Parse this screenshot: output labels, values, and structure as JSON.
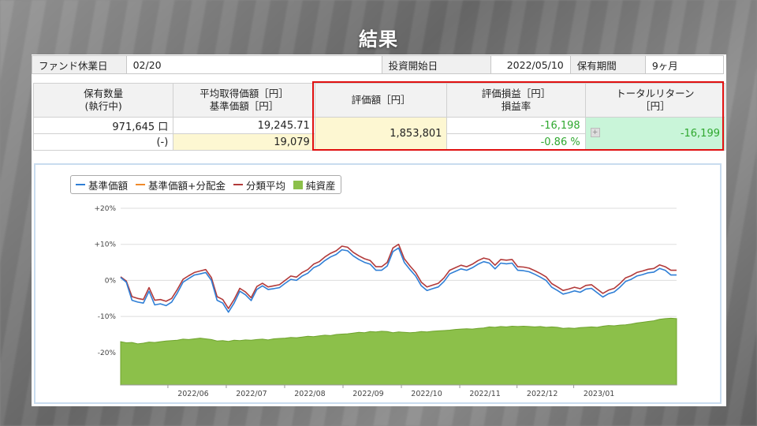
{
  "title": "結果",
  "info": {
    "holiday_label": "ファンド休業日",
    "holiday_value": "02/20",
    "start_label": "投資開始日",
    "start_value": "2022/05/10",
    "period_label": "保有期間",
    "period_value": "9ヶ月"
  },
  "summary": {
    "h_qty_1": "保有数量",
    "h_qty_2": "(執行中)",
    "h_avg_1": "平均取得価額［円］",
    "h_avg_2": "基準価額［円］",
    "h_val": "評価額［円］",
    "h_pl_1": "評価損益［円］",
    "h_pl_2": "損益率",
    "h_tr_1": "トータルリターン",
    "h_tr_2": "［円］",
    "qty": "971,645 口",
    "pending": "(-)",
    "avg_price": "19,245.71",
    "base_price": "19,079",
    "valuation": "1,853,801",
    "pl": "-16,198",
    "pl_rate": "-0.86 %",
    "total_return": "-16,199"
  },
  "legend": {
    "s1": "基準価額",
    "s2": "基準価額+分配金",
    "s3": "分類平均",
    "s4": "純資産"
  },
  "colors": {
    "s1": "#2f7fd6",
    "s2": "#f08a2a",
    "s3": "#b23a3a",
    "s4": "#8cc04a",
    "highlight": "#e01010"
  },
  "chart_data": {
    "type": "line",
    "y_ticks": [
      "+20%",
      "+10%",
      "0%",
      "-10%",
      "-20%"
    ],
    "ylim": [
      -29,
      20
    ],
    "x_ticks": [
      "2022/06",
      "2022/07",
      "2022/08",
      "2022/09",
      "2022/10",
      "2022/11",
      "2022/12",
      "2023/01"
    ],
    "x_tick_pos": [
      0.085,
      0.19,
      0.295,
      0.4,
      0.505,
      0.61,
      0.713,
      0.815
    ],
    "series": [
      {
        "name": "基準価額",
        "values": [
          0.8,
          -0.5,
          -5.5,
          -6,
          -6.3,
          -3,
          -6.8,
          -6.5,
          -7,
          -6,
          -3.5,
          -0.5,
          0.5,
          1.5,
          1.8,
          2.2,
          0,
          -5.5,
          -6.3,
          -8.8,
          -6.3,
          -3,
          -4,
          -5.6,
          -2.5,
          -1.5,
          -2.5,
          -2.3,
          -2,
          -0.8,
          0.3,
          0,
          1.2,
          2,
          3.5,
          4.2,
          5.5,
          6.5,
          7.2,
          8.5,
          8.2,
          6.8,
          5.8,
          5,
          4.5,
          2.8,
          2.8,
          4,
          8,
          9,
          5,
          3,
          1.2,
          -1.5,
          -2.8,
          -2.3,
          -1.8,
          -0.3,
          1.8,
          2.5,
          3.2,
          2.8,
          3.5,
          4.5,
          5.2,
          4.8,
          3.2,
          4.8,
          4.6,
          4.8,
          2.8,
          2.7,
          2.4,
          1.7,
          0.9,
          0,
          -1.9,
          -2.8,
          -3.8,
          -3.4,
          -2.9,
          -3.3,
          -2.4,
          -2.2,
          -3.4,
          -4.6,
          -3.7,
          -3.2,
          -1.9,
          -0.3,
          0.3,
          1.2,
          1.6,
          2.1,
          2.3,
          3.3,
          2.8,
          1.5,
          1.5
        ]
      },
      {
        "name": "分類平均",
        "values": [
          1,
          -0.2,
          -4.5,
          -5,
          -5.3,
          -2,
          -5.5,
          -5.3,
          -5.8,
          -5,
          -2.5,
          0.3,
          1.3,
          2.2,
          2.6,
          3,
          0.8,
          -4.5,
          -5.3,
          -7.8,
          -5.3,
          -2.2,
          -3.2,
          -4.8,
          -1.7,
          -0.8,
          -1.8,
          -1.5,
          -1.2,
          0,
          1.2,
          0.9,
          2.2,
          3,
          4.5,
          5.2,
          6.5,
          7.5,
          8.2,
          9.5,
          9.2,
          7.8,
          6.8,
          6,
          5.5,
          3.8,
          3.8,
          5,
          9,
          10,
          6,
          4,
          2.2,
          -0.5,
          -1.8,
          -1.3,
          -0.8,
          0.7,
          2.8,
          3.5,
          4.2,
          3.8,
          4.5,
          5.5,
          6.2,
          5.8,
          4.2,
          5.8,
          5.6,
          5.8,
          3.8,
          3.7,
          3.4,
          2.7,
          1.9,
          1,
          -0.9,
          -1.8,
          -2.8,
          -2.4,
          -1.9,
          -2.3,
          -1.4,
          -1.2,
          -2.4,
          -3.6,
          -2.7,
          -2.2,
          -0.9,
          0.7,
          1.3,
          2.2,
          2.6,
          3.1,
          3.3,
          4.3,
          3.8,
          2.8,
          2.8
        ]
      },
      {
        "name": "純資産",
        "values": [
          -17,
          -17.3,
          -17.2,
          -17.6,
          -17.4,
          -17.1,
          -17.2,
          -17,
          -16.8,
          -16.7,
          -16.6,
          -16.3,
          -16.4,
          -16.2,
          -16,
          -16.2,
          -16.4,
          -16.8,
          -16.7,
          -16.9,
          -16.6,
          -16.7,
          -16.5,
          -16.6,
          -16.4,
          -16.3,
          -16.5,
          -16.2,
          -16.1,
          -16,
          -15.8,
          -15.9,
          -15.7,
          -15.5,
          -15.6,
          -15.4,
          -15.2,
          -15.3,
          -15,
          -14.9,
          -14.8,
          -14.6,
          -14.4,
          -14.5,
          -14.2,
          -14.3,
          -14.1,
          -14.2,
          -14.5,
          -14.3,
          -14.4,
          -14.5,
          -14.4,
          -14.2,
          -14.3,
          -14.1,
          -14,
          -13.9,
          -13.8,
          -13.6,
          -13.5,
          -13.4,
          -13.5,
          -13.3,
          -13.2,
          -12.9,
          -13,
          -12.8,
          -12.9,
          -12.7,
          -12.8,
          -12.7,
          -12.8,
          -12.9,
          -12.8,
          -13,
          -12.9,
          -13,
          -13.3,
          -13.2,
          -13.3,
          -13.1,
          -13,
          -12.9,
          -13,
          -12.7,
          -12.5,
          -12.6,
          -12.4,
          -12.3,
          -12.1,
          -11.8,
          -11.6,
          -11.4,
          -11.2,
          -10.8,
          -10.6,
          -10.5,
          -10.6
        ]
      }
    ]
  }
}
